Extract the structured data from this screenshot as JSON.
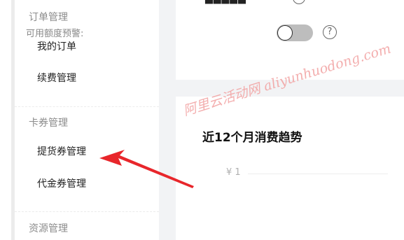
{
  "sidebar": {
    "groups": [
      {
        "label": "订单管理"
      },
      {
        "label": "卡券管理"
      },
      {
        "label": "资源管理"
      }
    ],
    "items": [
      {
        "label": "我的订单"
      },
      {
        "label": "续费管理"
      },
      {
        "label": "提货券管理"
      },
      {
        "label": "代金券管理"
      }
    ]
  },
  "main": {
    "quota_warning_label": "可用额度预警:",
    "quota_warning_enabled": false,
    "help_glyph": "?",
    "chart_title": "近12个月消费趋势",
    "axis_tick": "¥ 1"
  },
  "watermark": "阿里云活动网 aliyunhuodong.com",
  "colors": {
    "annotation_arrow": "#e8262b",
    "watermark": "#f2a0a0"
  }
}
